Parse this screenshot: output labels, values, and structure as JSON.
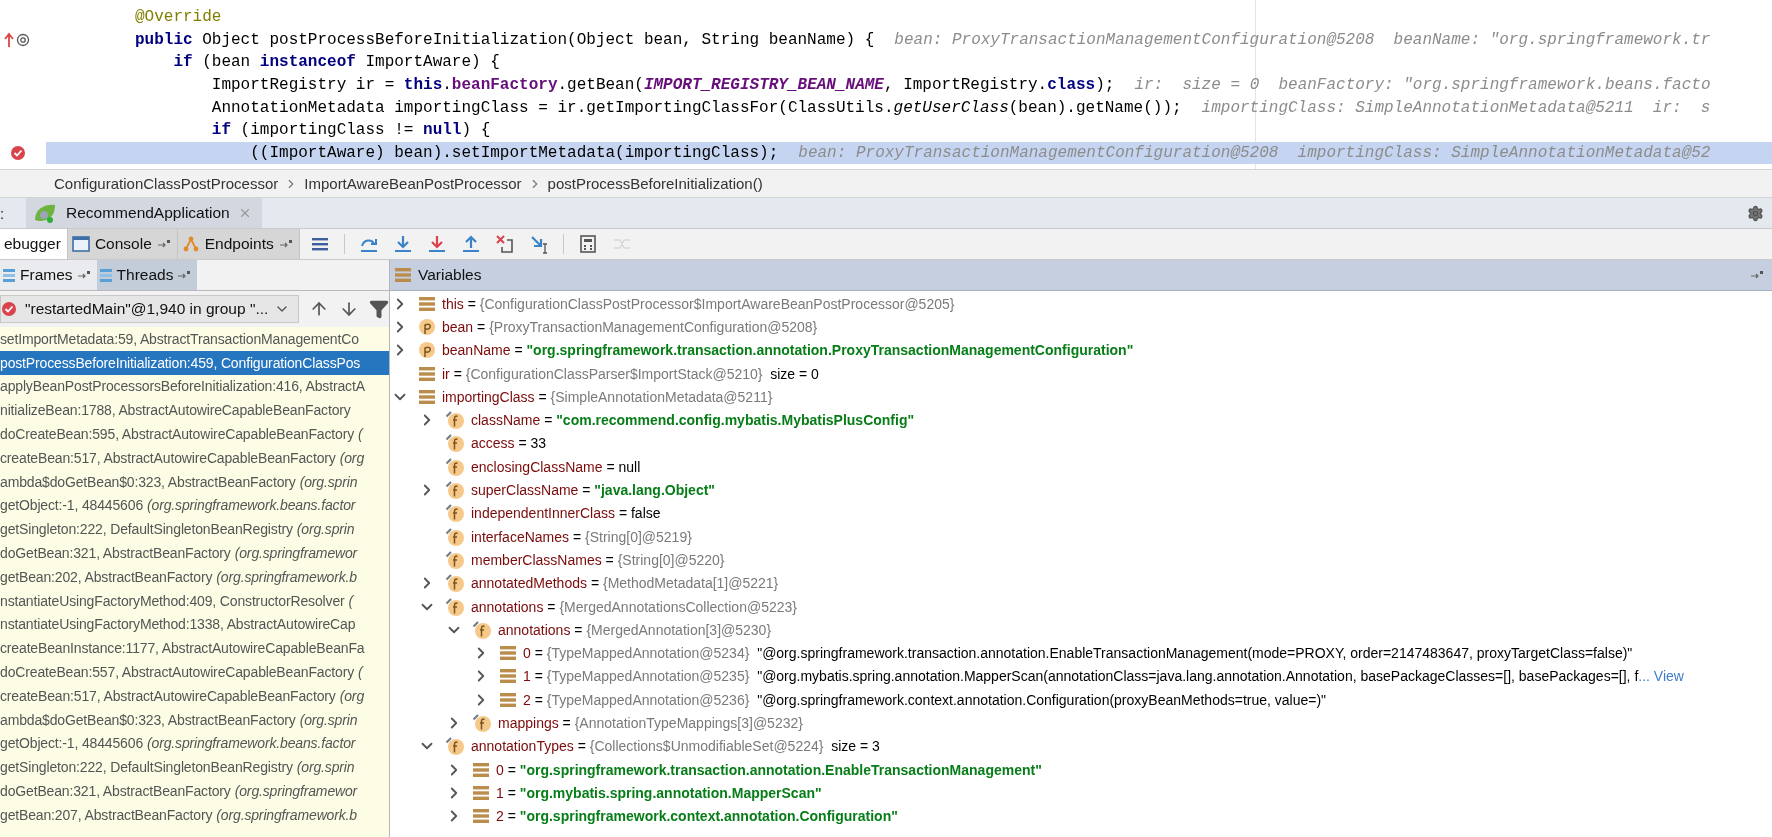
{
  "editor": {
    "lines": [
      {
        "kind": "plain",
        "current": false,
        "tokens": [
          {
            "kind": "annotation",
            "text": "@Override"
          }
        ]
      },
      {
        "kind": "override",
        "current": false,
        "tokens": [
          {
            "kind": "keyword",
            "text": "public"
          },
          {
            "kind": "plain",
            "text": " Object postProcessBeforeInitialization(Object bean, String beanName) {"
          }
        ],
        "hint": "bean: ProxyTransactionManagementConfiguration@5208  beanName: \"org.springframework.tr"
      },
      {
        "kind": "plain",
        "current": false,
        "tokens": [
          {
            "kind": "keyword",
            "text": "    if"
          },
          {
            "kind": "plain",
            "text": " (bean "
          },
          {
            "kind": "keyword",
            "text": "instanceof"
          },
          {
            "kind": "plain",
            "text": " ImportAware) {"
          }
        ]
      },
      {
        "kind": "plain",
        "current": false,
        "tokens": [
          {
            "kind": "plain",
            "text": "        ImportRegistry ir = "
          },
          {
            "kind": "keyword",
            "text": "this"
          },
          {
            "kind": "plain",
            "text": "."
          },
          {
            "kind": "field",
            "text": "beanFactory"
          },
          {
            "kind": "plain",
            "text": ".getBean("
          },
          {
            "kind": "constant",
            "text": "IMPORT_REGISTRY_BEAN_NAME"
          },
          {
            "kind": "plain",
            "text": ", ImportRegistry."
          },
          {
            "kind": "keyword",
            "text": "class"
          },
          {
            "kind": "plain",
            "text": ");"
          }
        ],
        "hint": "ir:  size = 0  beanFactory: \"org.springframework.beans.facto"
      },
      {
        "kind": "plain",
        "current": false,
        "tokens": [
          {
            "kind": "plain",
            "text": "        AnnotationMetadata importingClass = ir.getImportingClassFor(ClassUtils."
          },
          {
            "kind": "static",
            "text": "getUserClass"
          },
          {
            "kind": "plain",
            "text": "(bean).getName());"
          }
        ],
        "hint": "importingClass: SimpleAnnotationMetadata@5211  ir:  s"
      },
      {
        "kind": "plain",
        "current": false,
        "tokens": [
          {
            "kind": "keyword",
            "text": "        if"
          },
          {
            "kind": "plain",
            "text": " (importingClass != "
          },
          {
            "kind": "keyword",
            "text": "null"
          },
          {
            "kind": "plain",
            "text": ") {"
          }
        ]
      },
      {
        "kind": "breakpoint",
        "current": true,
        "tokens": [
          {
            "kind": "plain",
            "text": "            ((ImportAware) bean).setImportMetadata(importingClass);"
          }
        ],
        "hint": "bean: ProxyTransactionManagementConfiguration@5208  importingClass: SimpleAnnotationMetadata@52"
      }
    ]
  },
  "breadcrumbs": [
    "ConfigurationClassPostProcessor",
    "ImportAwareBeanPostProcessor",
    "postProcessBeforeInitialization()"
  ],
  "run_tabs": {
    "prefix": ":",
    "tabs": [
      {
        "label": "RecommendApplication",
        "selected": true
      }
    ]
  },
  "debug_tabs": [
    {
      "label": "ebugger",
      "selected": true,
      "kind": "plain"
    },
    {
      "label": "Console",
      "selected": false,
      "kind": "console"
    },
    {
      "label": "Endpoints",
      "selected": false,
      "kind": "endpoints"
    }
  ],
  "toolbar_actions": [
    {
      "kind": "layout",
      "disabled": false
    },
    {
      "kind": "step-over",
      "disabled": false
    },
    {
      "kind": "step-into",
      "disabled": false
    },
    {
      "kind": "force-step-into",
      "disabled": false
    },
    {
      "kind": "step-out",
      "disabled": false
    },
    {
      "kind": "drop-frame",
      "disabled": false
    },
    {
      "kind": "run-to-cursor",
      "disabled": false
    },
    {
      "kind": "evaluate",
      "disabled": false
    },
    {
      "kind": "trace",
      "disabled": true
    }
  ],
  "frames_tabs": [
    {
      "label": "Frames",
      "selected": false
    },
    {
      "label": "Threads",
      "selected": true
    }
  ],
  "thread_selector": {
    "value": "\"restartedMain\"@1,940 in group \"..."
  },
  "frames": [
    {
      "method": "setImportMetadata:59, AbstractTransactionManagementCo",
      "selected": false
    },
    {
      "method": "postProcessBeforeInitialization:459, ConfigurationClassPos",
      "selected": true
    },
    {
      "method": "applyBeanPostProcessorsBeforeInitialization:416, AbstractA",
      "selected": false
    },
    {
      "method": "nitializeBean:1788, AbstractAutowireCapableBeanFactory",
      "selected": false
    },
    {
      "method": "doCreateBean:595, AbstractAutowireCapableBeanFactory",
      "package": "(",
      "selected": false
    },
    {
      "method": "createBean:517, AbstractAutowireCapableBeanFactory",
      "package": "(org",
      "selected": false
    },
    {
      "method": "ambda$doGetBean$0:323, AbstractBeanFactory",
      "package": "(org.sprin",
      "selected": false
    },
    {
      "method": "getObject:-1, 48445606",
      "package": "(org.springframework.beans.factor",
      "selected": false
    },
    {
      "method": "getSingleton:222, DefaultSingletonBeanRegistry",
      "package": "(org.sprin",
      "selected": false
    },
    {
      "method": "doGetBean:321, AbstractBeanFactory",
      "package": "(org.springframewor",
      "selected": false
    },
    {
      "method": "getBean:202, AbstractBeanFactory",
      "package": "(org.springframework.b",
      "selected": false
    },
    {
      "method": "nstantiateUsingFactoryMethod:409, ConstructorResolver",
      "package": "(",
      "selected": false
    },
    {
      "method": "nstantiateUsingFactoryMethod:1338, AbstractAutowireCap",
      "selected": false
    },
    {
      "method": "createBeanInstance:1177, AbstractAutowireCapableBeanFa",
      "selected": false
    },
    {
      "method": "doCreateBean:557, AbstractAutowireCapableBeanFactory",
      "package": "(",
      "selected": false
    },
    {
      "method": "createBean:517, AbstractAutowireCapableBeanFactory",
      "package": "(org",
      "selected": false
    },
    {
      "method": "ambda$doGetBean$0:323, AbstractBeanFactory",
      "package": "(org.sprin",
      "selected": false
    },
    {
      "method": "getObject:-1, 48445606",
      "package": "(org.springframework.beans.factor",
      "selected": false
    },
    {
      "method": "getSingleton:222, DefaultSingletonBeanRegistry",
      "package": "(org.sprin",
      "selected": false
    },
    {
      "method": "doGetBean:321, AbstractBeanFactory",
      "package": "(org.springframewor",
      "selected": false
    },
    {
      "method": "getBean:207, AbstractBeanFactory",
      "package": "(org.springframework.b",
      "selected": false
    }
  ],
  "variables": {
    "title": "Variables",
    "items": [
      {
        "kind": "local",
        "expanded": false,
        "name": "this",
        "sep": "=",
        "value": {
          "kind": "object",
          "text": "{ConfigurationClassPostProcessor$ImportAwareBeanPostProcessor@5205}"
        }
      },
      {
        "kind": "param",
        "expanded": false,
        "name": "bean",
        "sep": "=",
        "value": {
          "kind": "object",
          "text": "{ProxyTransactionManagementConfiguration@5208}"
        }
      },
      {
        "kind": "param",
        "expanded": false,
        "name": "beanName",
        "sep": "=",
        "value": {
          "kind": "string",
          "text": "\"org.springframework.transaction.annotation.ProxyTransactionManagementConfiguration\""
        }
      },
      {
        "kind": "local",
        "name": "ir",
        "sep": "=",
        "value": {
          "kind": "object",
          "text": "{ConfigurationClassParser$ImportStack@5210}"
        },
        "extra": "size = 0"
      },
      {
        "kind": "local",
        "expanded": true,
        "name": "importingClass",
        "sep": "=",
        "value": {
          "kind": "object",
          "text": "{SimpleAnnotationMetadata@5211}"
        },
        "children": [
          {
            "kind": "field",
            "expanded": false,
            "name": "className",
            "sep": "=",
            "value": {
              "kind": "string",
              "text": "\"com.recommend.config.mybatis.MybatisPlusConfig\""
            }
          },
          {
            "kind": "field",
            "name": "access",
            "sep": "=",
            "value": {
              "kind": "plain",
              "text": "33"
            }
          },
          {
            "kind": "field",
            "name": "enclosingClassName",
            "sep": "=",
            "value": {
              "kind": "plain",
              "text": "null"
            }
          },
          {
            "kind": "field",
            "expanded": false,
            "name": "superClassName",
            "sep": "=",
            "value": {
              "kind": "string",
              "text": "\"java.lang.Object\""
            }
          },
          {
            "kind": "field",
            "name": "independentInnerClass",
            "sep": "=",
            "value": {
              "kind": "plain",
              "text": "false"
            }
          },
          {
            "kind": "field",
            "name": "interfaceNames",
            "sep": "=",
            "value": {
              "kind": "object",
              "text": "{String[0]@5219}"
            }
          },
          {
            "kind": "field",
            "name": "memberClassNames",
            "sep": "=",
            "value": {
              "kind": "object",
              "text": "{String[0]@5220}"
            }
          },
          {
            "kind": "field",
            "expanded": false,
            "name": "annotatedMethods",
            "sep": "=",
            "value": {
              "kind": "object",
              "text": "{MethodMetadata[1]@5221}"
            }
          },
          {
            "kind": "field",
            "expanded": true,
            "name": "annotations",
            "sep": "=",
            "value": {
              "kind": "object",
              "text": "{MergedAnnotationsCollection@5223}"
            },
            "children": [
              {
                "kind": "field",
                "expanded": true,
                "name": "annotations",
                "sep": "=",
                "value": {
                  "kind": "object",
                  "text": "{MergedAnnotation[3]@5230}"
                },
                "children": [
                  {
                    "kind": "local",
                    "expanded": false,
                    "name": "0",
                    "sep": "=",
                    "value": {
                      "kind": "object",
                      "text": "{TypeMappedAnnotation@5234}"
                    },
                    "extra": "\"@org.springframework.transaction.annotation.EnableTransactionManagement(mode=PROXY, order=2147483647, proxyTargetClass=false)\""
                  },
                  {
                    "kind": "local",
                    "expanded": false,
                    "name": "1",
                    "sep": "=",
                    "value": {
                      "kind": "object",
                      "text": "{TypeMappedAnnotation@5235}"
                    },
                    "extra": "\"@org.mybatis.spring.annotation.MapperScan(annotationClass=java.lang.annotation.Annotation, basePackageClasses=[], basePackages=[], f",
                    "link": "... View"
                  },
                  {
                    "kind": "local",
                    "expanded": false,
                    "name": "2",
                    "sep": "=",
                    "value": {
                      "kind": "object",
                      "text": "{TypeMappedAnnotation@5236}"
                    },
                    "extra": "\"@org.springframework.context.annotation.Configuration(proxyBeanMethods=true, value=)\""
                  }
                ]
              },
              {
                "kind": "field",
                "expanded": false,
                "name": "mappings",
                "sep": "=",
                "value": {
                  "kind": "object",
                  "text": "{AnnotationTypeMappings[3]@5232}"
                }
              }
            ]
          },
          {
            "kind": "field",
            "expanded": true,
            "name": "annotationTypes",
            "sep": "=",
            "value": {
              "kind": "object",
              "text": "{Collections$UnmodifiableSet@5224}"
            },
            "extra": "size = 3",
            "children": [
              {
                "kind": "local",
                "expanded": false,
                "name": "0",
                "sep": "=",
                "value": {
                  "kind": "string",
                  "text": "\"org.springframework.transaction.annotation.EnableTransactionManagement\""
                }
              },
              {
                "kind": "local",
                "expanded": false,
                "name": "1",
                "sep": "=",
                "value": {
                  "kind": "string",
                  "text": "\"org.mybatis.spring.annotation.MapperScan\""
                }
              },
              {
                "kind": "local",
                "expanded": false,
                "name": "2",
                "sep": "=",
                "value": {
                  "kind": "string",
                  "text": "\"org.springframework.context.annotation.Configuration\""
                }
              }
            ]
          }
        ]
      }
    ]
  }
}
